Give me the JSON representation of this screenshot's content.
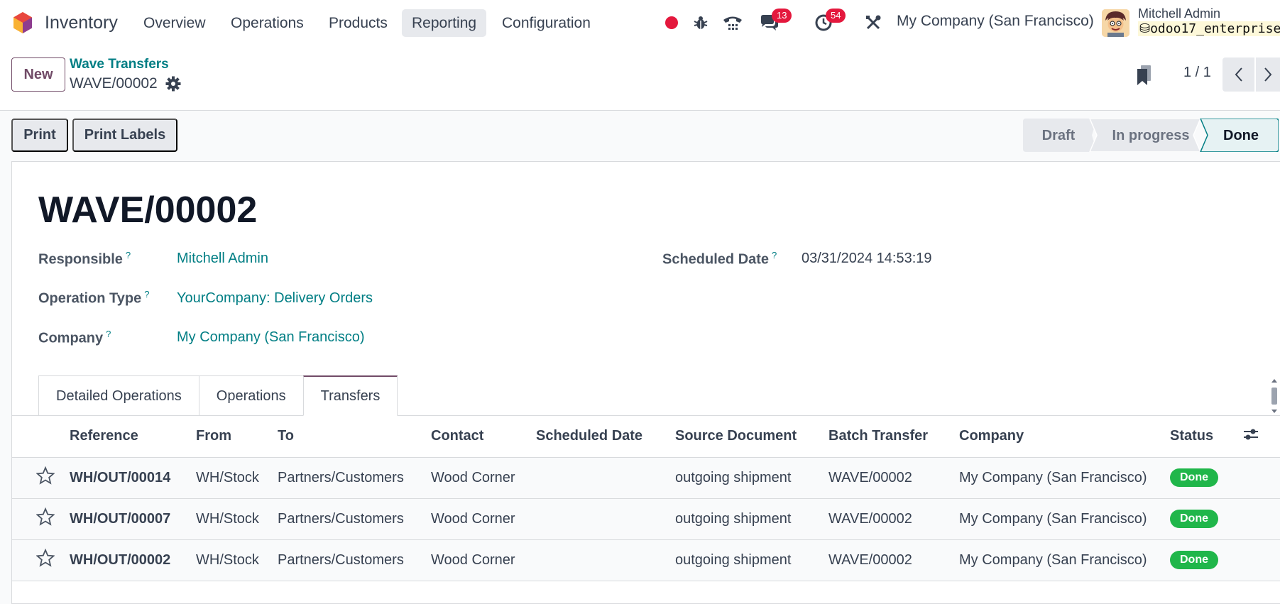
{
  "navbar": {
    "app_name": "Inventory",
    "menus": [
      "Overview",
      "Operations",
      "Products",
      "Reporting",
      "Configuration"
    ],
    "active_menu": "Reporting",
    "chat_count": "13",
    "activity_count": "54",
    "company": "My Company (San Francisco)",
    "user_name": "Mitchell Admin",
    "database": "odoo17_enterprise"
  },
  "control_panel": {
    "new_label": "New",
    "breadcrumb_parent": "Wave Transfers",
    "breadcrumb_current": "WAVE/00002",
    "pager": "1 / 1"
  },
  "actions": {
    "print": "Print",
    "print_labels": "Print Labels"
  },
  "statusbar": {
    "stages": [
      "Draft",
      "In progress",
      "Done"
    ],
    "current": "Done"
  },
  "record": {
    "title": "WAVE/00002",
    "fields": {
      "responsible_label": "Responsible",
      "responsible_value": "Mitchell Admin",
      "operation_type_label": "Operation Type",
      "operation_type_value": "YourCompany: Delivery Orders",
      "company_label": "Company",
      "company_value": "My Company (San Francisco)",
      "scheduled_date_label": "Scheduled Date",
      "scheduled_date_value": "03/31/2024 14:53:19",
      "help_mark": "?"
    }
  },
  "tabs": [
    "Detailed Operations",
    "Operations",
    "Transfers"
  ],
  "active_tab": "Transfers",
  "transfers": {
    "columns": [
      "Reference",
      "From",
      "To",
      "Contact",
      "Scheduled Date",
      "Source Document",
      "Batch Transfer",
      "Company",
      "Status"
    ],
    "rows": [
      {
        "reference": "WH/OUT/00014",
        "from": "WH/Stock",
        "to": "Partners/Customers",
        "contact": "Wood Corner",
        "scheduled_date": "",
        "source": "outgoing shipment",
        "batch": "WAVE/00002",
        "company": "My Company (San Francisco)",
        "status": "Done"
      },
      {
        "reference": "WH/OUT/00007",
        "from": "WH/Stock",
        "to": "Partners/Customers",
        "contact": "Wood Corner",
        "scheduled_date": "",
        "source": "outgoing shipment",
        "batch": "WAVE/00002",
        "company": "My Company (San Francisco)",
        "status": "Done"
      },
      {
        "reference": "WH/OUT/00002",
        "from": "WH/Stock",
        "to": "Partners/Customers",
        "contact": "Wood Corner",
        "scheduled_date": "",
        "source": "outgoing shipment",
        "batch": "WAVE/00002",
        "company": "My Company (San Francisco)",
        "status": "Done"
      }
    ]
  },
  "colors": {
    "brand": "#714b67",
    "link": "#017e84",
    "success": "#20b64a",
    "badge": "#e4183d"
  },
  "icons": [
    "odoo-logo-icon",
    "recording-dot-icon",
    "bug-icon",
    "phone-icon",
    "chat-icon",
    "clock-icon",
    "tools-icon",
    "gear-icon",
    "bookmark-icon",
    "chevron-left-icon",
    "chevron-right-icon",
    "star-icon",
    "column-settings-icon"
  ]
}
